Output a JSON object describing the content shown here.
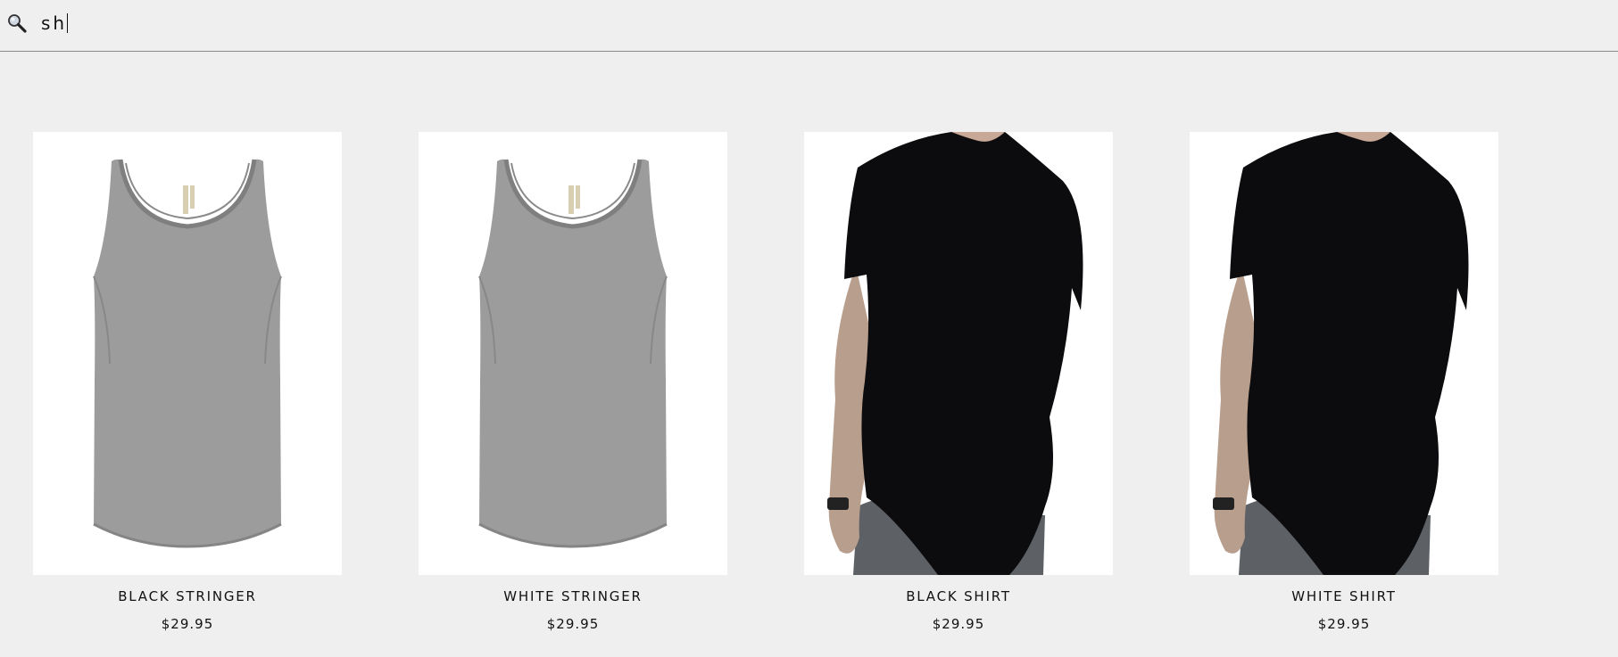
{
  "search": {
    "value": "sh",
    "icon": "search-icon"
  },
  "products": [
    {
      "name": "BLACK STRINGER",
      "price": "$29.95",
      "image": "grey-tank-top",
      "shirt_color": "#9c9c9c"
    },
    {
      "name": "WHITE STRINGER",
      "price": "$29.95",
      "image": "grey-tank-top",
      "shirt_color": "#9c9c9c"
    },
    {
      "name": "BLACK SHIRT",
      "price": "$29.95",
      "image": "black-tshirt-back",
      "shirt_color": "#0c0c0e"
    },
    {
      "name": "WHITE SHIRT",
      "price": "$29.95",
      "image": "black-tshirt-back",
      "shirt_color": "#0c0c0e"
    }
  ],
  "colors": {
    "background": "#efefef",
    "divider": "#8a8a8a",
    "card_bg": "#ffffff"
  }
}
